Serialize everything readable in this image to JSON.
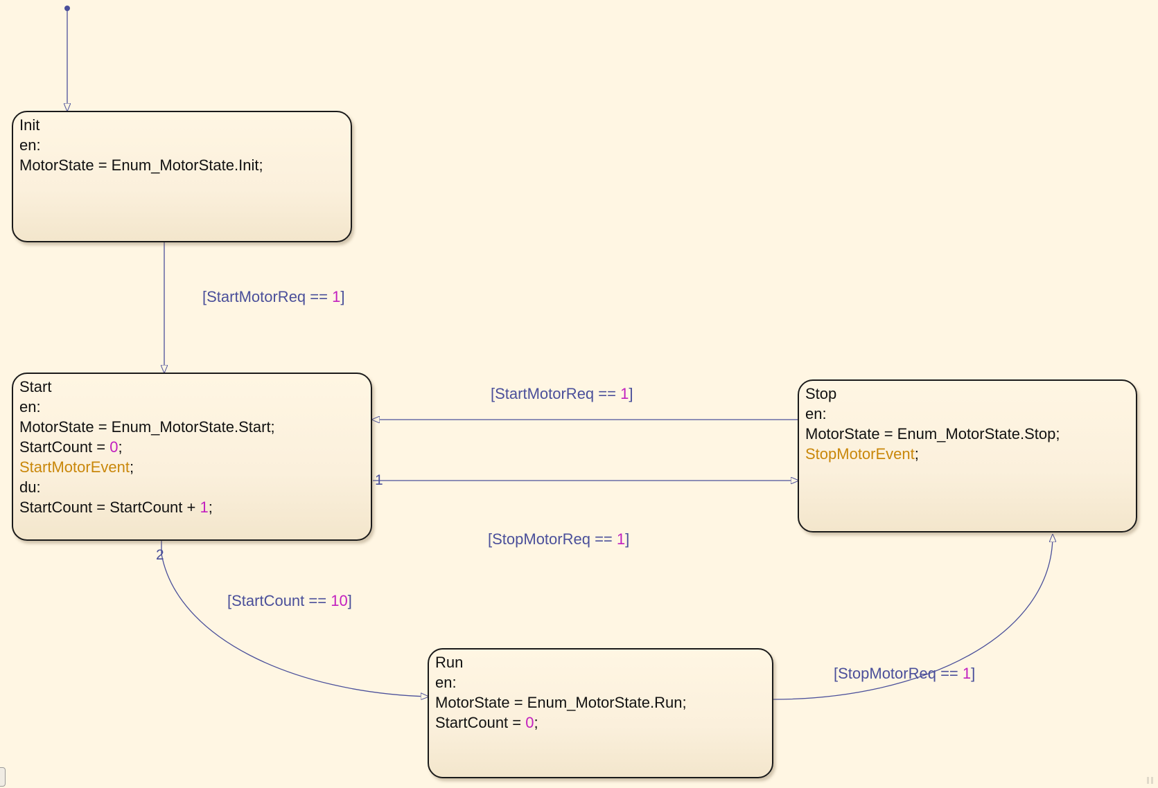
{
  "colors": {
    "background": "#fff6e3",
    "transition": "#4a4f9a",
    "number": "#c21fbf",
    "event": "#c9870a",
    "text": "#111111"
  },
  "states": {
    "init": {
      "name": "Init",
      "lines": [
        [
          {
            "t": "en:"
          }
        ],
        [
          {
            "t": "MotorState = Enum_MotorState.Init;"
          }
        ]
      ]
    },
    "start": {
      "name": "Start",
      "lines": [
        [
          {
            "t": "en:"
          }
        ],
        [
          {
            "t": "MotorState = Enum_MotorState.Start;"
          }
        ],
        [
          {
            "t": "StartCount = "
          },
          {
            "t": "0",
            "k": "num"
          },
          {
            "t": ";"
          }
        ],
        [
          {
            "t": "StartMotorEvent",
            "k": "evt"
          },
          {
            "t": ";"
          }
        ],
        [
          {
            "t": "du:"
          }
        ],
        [
          {
            "t": "StartCount = StartCount + "
          },
          {
            "t": "1",
            "k": "num"
          },
          {
            "t": ";"
          }
        ]
      ]
    },
    "stop": {
      "name": "Stop",
      "lines": [
        [
          {
            "t": "en:"
          }
        ],
        [
          {
            "t": "MotorState = Enum_MotorState.Stop;"
          }
        ],
        [
          {
            "t": "StopMotorEvent",
            "k": "evt"
          },
          {
            "t": ";"
          }
        ]
      ]
    },
    "run": {
      "name": "Run",
      "lines": [
        [
          {
            "t": "en:"
          }
        ],
        [
          {
            "t": "MotorState = Enum_MotorState.Run;"
          }
        ],
        [
          {
            "t": "StartCount = "
          },
          {
            "t": "0",
            "k": "num"
          },
          {
            "t": ";"
          }
        ]
      ]
    }
  },
  "transitions": {
    "init_to_start": [
      {
        "t": "[StartMotorReq == "
      },
      {
        "t": "1",
        "k": "num"
      },
      {
        "t": "]"
      }
    ],
    "stop_to_start": [
      {
        "t": "[StartMotorReq == "
      },
      {
        "t": "1",
        "k": "num"
      },
      {
        "t": "]"
      }
    ],
    "start_to_stop": [
      {
        "t": "[StopMotorReq == "
      },
      {
        "t": "1",
        "k": "num"
      },
      {
        "t": "]"
      }
    ],
    "start_to_run": [
      {
        "t": "[StartCount == "
      },
      {
        "t": "10",
        "k": "num"
      },
      {
        "t": "]"
      }
    ],
    "run_to_stop": [
      {
        "t": "[StopMotorReq == "
      },
      {
        "t": "1",
        "k": "num"
      },
      {
        "t": "]"
      }
    ]
  },
  "execution_order": {
    "start_to_stop": "1",
    "start_to_run": "2"
  }
}
